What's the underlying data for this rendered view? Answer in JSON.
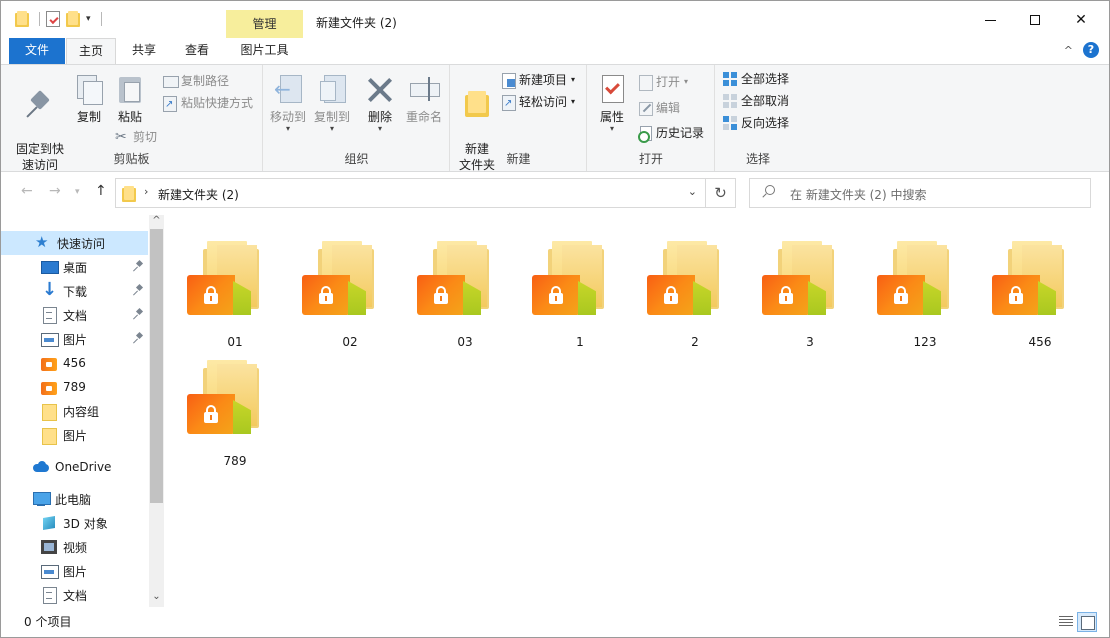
{
  "window": {
    "title": "新建文件夹 (2)",
    "context_tab_group": "管理"
  },
  "tabs": [
    "文件",
    "主页",
    "共享",
    "查看",
    "图片工具"
  ],
  "ribbon": {
    "clipboard": {
      "label": "剪贴板",
      "pin": "固定到快\n速访问",
      "copy": "复制",
      "paste": "粘贴",
      "copy_path": "复制路径",
      "paste_shortcut": "粘贴快捷方式",
      "cut": "剪切"
    },
    "organize": {
      "label": "组织",
      "move_to": "移动到",
      "copy_to": "复制到",
      "delete": "删除",
      "rename": "重命名"
    },
    "new": {
      "label": "新建",
      "new_folder": "新建\n文件夹",
      "new_item": "新建项目",
      "easy_access": "轻松访问"
    },
    "open": {
      "label": "打开",
      "properties": "属性",
      "open": "打开",
      "edit": "编辑",
      "history": "历史记录"
    },
    "select": {
      "label": "选择",
      "select_all": "全部选择",
      "select_none": "全部取消",
      "invert": "反向选择"
    }
  },
  "address": {
    "crumb": "新建文件夹 (2)",
    "search_placeholder": "在 新建文件夹 (2) 中搜索"
  },
  "nav": {
    "quick_access": "快速访问",
    "quick_items": [
      {
        "label": "桌面",
        "icon": "desktop-icon",
        "pinned": true
      },
      {
        "label": "下载",
        "icon": "download-icon",
        "pinned": true
      },
      {
        "label": "文档",
        "icon": "documents-icon",
        "pinned": true
      },
      {
        "label": "图片",
        "icon": "pictures-icon",
        "pinned": true
      },
      {
        "label": "456",
        "icon": "locked-folder-icon",
        "pinned": false
      },
      {
        "label": "789",
        "icon": "locked-folder-icon",
        "pinned": false
      },
      {
        "label": "内容组",
        "icon": "folder-icon",
        "pinned": false
      },
      {
        "label": "图片",
        "icon": "folder-icon",
        "pinned": false
      }
    ],
    "onedrive": "OneDrive",
    "this_pc": "此电脑",
    "pc_items": [
      {
        "label": "3D 对象",
        "icon": "3d-objects-icon"
      },
      {
        "label": "视频",
        "icon": "videos-icon"
      },
      {
        "label": "图片",
        "icon": "pictures-icon"
      },
      {
        "label": "文档",
        "icon": "documents-icon"
      }
    ]
  },
  "files": [
    "01",
    "02",
    "03",
    "1",
    "2",
    "3",
    "123",
    "456",
    "789"
  ],
  "status": {
    "count": "0 个项目"
  },
  "colors": {
    "file_tab": "#1c73cf",
    "manage_tab": "#f7ee9c",
    "selection": "#cce8ff",
    "lock_folder_orange": "#fb8a16"
  }
}
